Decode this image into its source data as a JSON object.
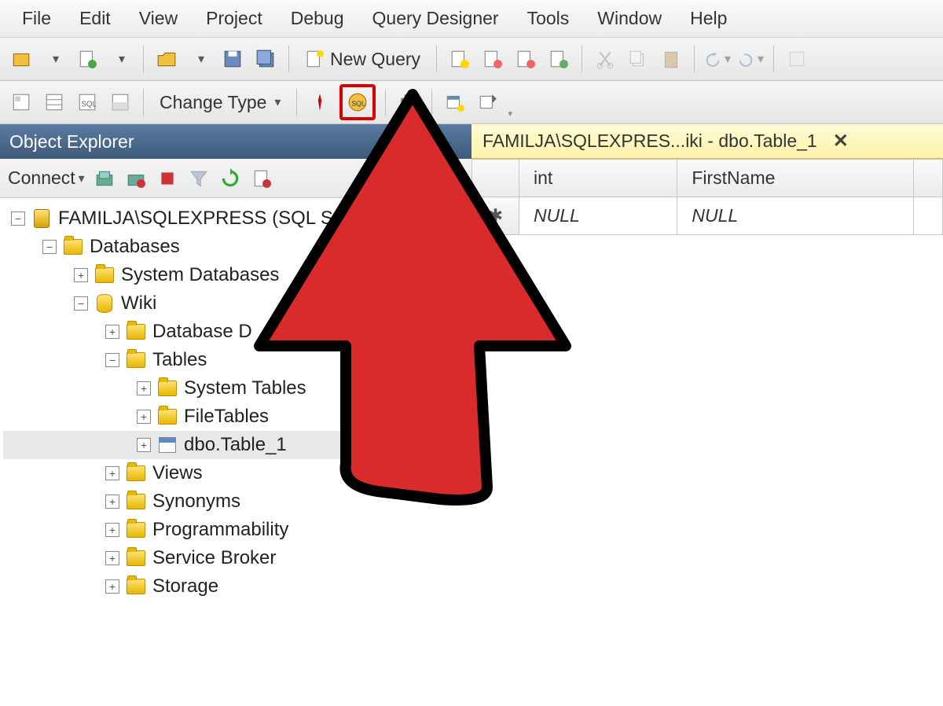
{
  "menu": [
    "File",
    "Edit",
    "View",
    "Project",
    "Debug",
    "Query Designer",
    "Tools",
    "Window",
    "Help"
  ],
  "toolbar1": {
    "new_query_label": "New Query"
  },
  "toolbar2": {
    "change_type_label": "Change Type"
  },
  "explorer": {
    "title": "Object Explorer",
    "connect_label": "Connect",
    "server": "FAMILJA\\SQLEXPRESS (SQL S",
    "nodes": {
      "databases": "Databases",
      "system_databases": "System Databases",
      "wiki": "Wiki",
      "database_d": "Database D",
      "tables": "Tables",
      "system_tables": "System Tables",
      "filetables": "FileTables",
      "dbo_table_1": "dbo.Table_1",
      "views": "Views",
      "synonyms": "Synonyms",
      "programmability": "Programmability",
      "service_broker": "Service Broker",
      "storage": "Storage"
    }
  },
  "tab": {
    "title": "FAMILJA\\SQLEXPRES...iki - dbo.Table_1"
  },
  "grid": {
    "headers": [
      "int",
      "FirstName"
    ],
    "row_marker": "✱",
    "cells": [
      "NULL",
      "NULL"
    ]
  }
}
